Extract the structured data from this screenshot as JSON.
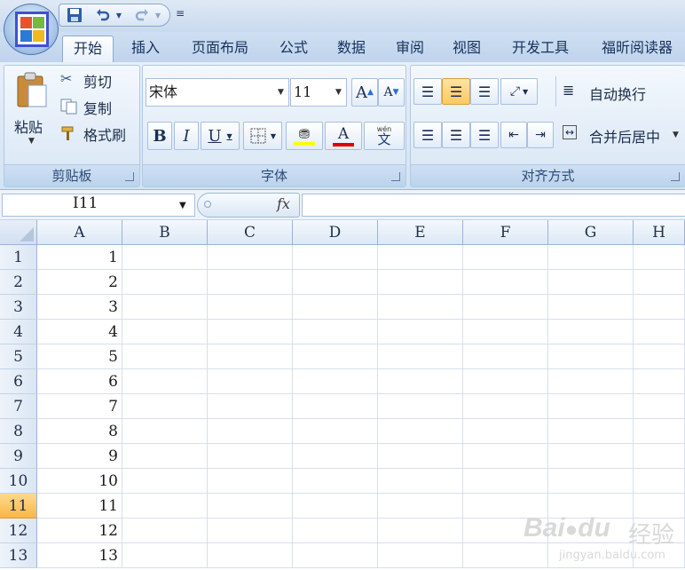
{
  "quick_access": {
    "more_symbol": "≡"
  },
  "tabs": [
    {
      "label": "开始",
      "active": true
    },
    {
      "label": "插入"
    },
    {
      "label": "页面布局"
    },
    {
      "label": "公式"
    },
    {
      "label": "数据"
    },
    {
      "label": "审阅"
    },
    {
      "label": "视图"
    },
    {
      "label": "开发工具"
    },
    {
      "label": "福昕阅读器"
    }
  ],
  "clipboard": {
    "title": "剪贴板",
    "paste": "粘贴",
    "cut": "剪切",
    "copy": "复制",
    "format_painter": "格式刷"
  },
  "font": {
    "title": "字体",
    "font_name": "宋体",
    "font_size": "11",
    "bold": "B",
    "italic": "I",
    "underline": "U",
    "grow": "A",
    "shrink": "A",
    "font_color": "A",
    "phonetic": "wén",
    "phonetic_char": "文",
    "highlight_color": "#ffff00",
    "text_color": "#e00000"
  },
  "alignment": {
    "title": "对齐方式",
    "wrap_text": "自动换行",
    "merge_center": "合并后居中"
  },
  "formula_bar": {
    "name_box": "I11",
    "fx": "fx",
    "formula": ""
  },
  "sheet": {
    "columns": [
      "A",
      "B",
      "C",
      "D",
      "E",
      "F",
      "G",
      "H"
    ],
    "rows": [
      "1",
      "2",
      "3",
      "4",
      "5",
      "6",
      "7",
      "8",
      "9",
      "10",
      "11",
      "12",
      "13"
    ],
    "active_row": "11",
    "column_a_values": [
      "1",
      "2",
      "3",
      "4",
      "5",
      "6",
      "7",
      "8",
      "9",
      "10",
      "11",
      "12",
      "13"
    ]
  },
  "watermark": {
    "brand": "Bai",
    "brand2": "du",
    "suffix": "经验",
    "url": "jingyan.baidu.com"
  }
}
